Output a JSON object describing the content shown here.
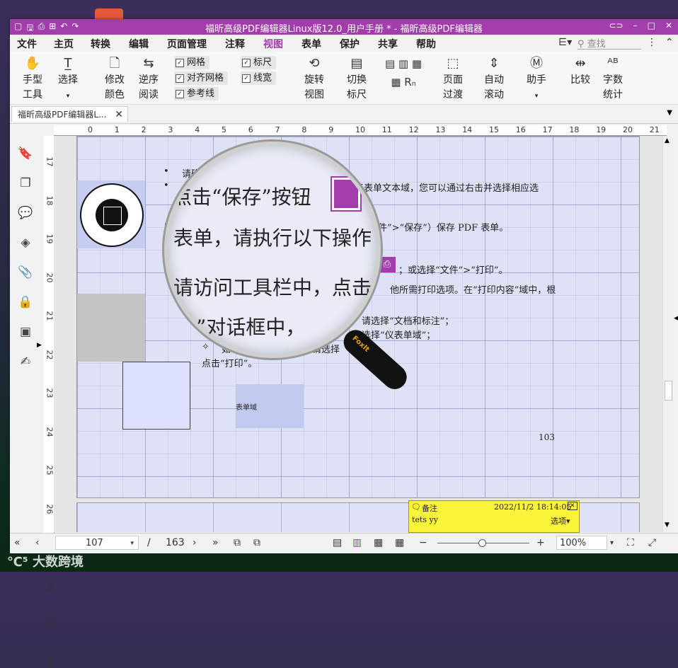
{
  "window": {
    "title": "福昕高级PDF编辑器Linux版12.0_用户手册 * - 福昕高级PDF编辑器"
  },
  "menu": [
    {
      "label": "文件"
    },
    {
      "label": "主页"
    },
    {
      "label": "转换"
    },
    {
      "label": "编辑"
    },
    {
      "label": "页面管理"
    },
    {
      "label": "注释"
    },
    {
      "label": "视图"
    },
    {
      "label": "表单"
    },
    {
      "label": "保护"
    },
    {
      "label": "共享"
    },
    {
      "label": "帮助"
    }
  ],
  "search": {
    "placeholder": "查找"
  },
  "ribbon": {
    "hand_tool": "手型\n工具",
    "select": "选择",
    "change_color": "修改\n颜色",
    "reverse_read": "逆序\n阅读",
    "grid": "网格",
    "snap_grid": "对齐网格",
    "guides": "参考线",
    "ruler": "标尺",
    "line_width": "线宽",
    "rotate_view": "旋转\n视图",
    "toggle_ruler": "切换\n标尺",
    "page_transition": "页面\n过渡",
    "auto_scroll": "自动\n滚动",
    "assistant": "助手",
    "compare": "比较",
    "word_count": "字数\n统计"
  },
  "checkboxes": {
    "grid": true,
    "snap_grid": true,
    "guides": true,
    "ruler": true,
    "line_width": true
  },
  "tab": {
    "label": "福昕高级PDF编辑器L..."
  },
  "hruler": [
    "0",
    "1",
    "2",
    "3",
    "4",
    "5",
    "6",
    "7",
    "8",
    "9",
    "10",
    "11",
    "12",
    "13",
    "14",
    "15",
    "16",
    "17",
    "18",
    "19",
    "20",
    "21"
  ],
  "vruler": [
    "17",
    "18",
    "19",
    "20",
    "21",
    "22",
    "23",
    "24",
    "25",
    "26",
    "27",
    "28",
    "29",
    "30"
  ],
  "page": {
    "line1": "请确",
    "line2": "于表单文本域，您可以通过右击并选择相应选",
    "line3": "文件”>“保存”）保存 PDF 表单。",
    "line4": "；或选择“文件”>“打印”。",
    "line5": "他所需打印选项。在“打印内容”域中，根",
    "line6": "请选择“文档和标注”；",
    "line7": "选择“仪表单域”；",
    "line8": "如",
    "line9": "请选择",
    "line10": "点击“打印”。",
    "form_label": "表单域",
    "page_number": "103"
  },
  "lens": {
    "l1": "点击“保存”按钮",
    "l2": "表单，请执行以下操作",
    "l3": "请访问工具栏中，点击",
    "l4": "”对话框中，",
    "brand": "FoxIt"
  },
  "note": {
    "title": "备注",
    "date": "2022/11/2",
    "time": "18:14:05",
    "author": "tets yy",
    "options": "选项"
  },
  "status": {
    "page": "107",
    "separator": "/",
    "total": "163",
    "zoom": "100%"
  },
  "watermark": "大数跨境",
  "colors": {
    "title_bar": "#a23dab",
    "accent": "#a23dab",
    "note": "#f9f33a"
  }
}
